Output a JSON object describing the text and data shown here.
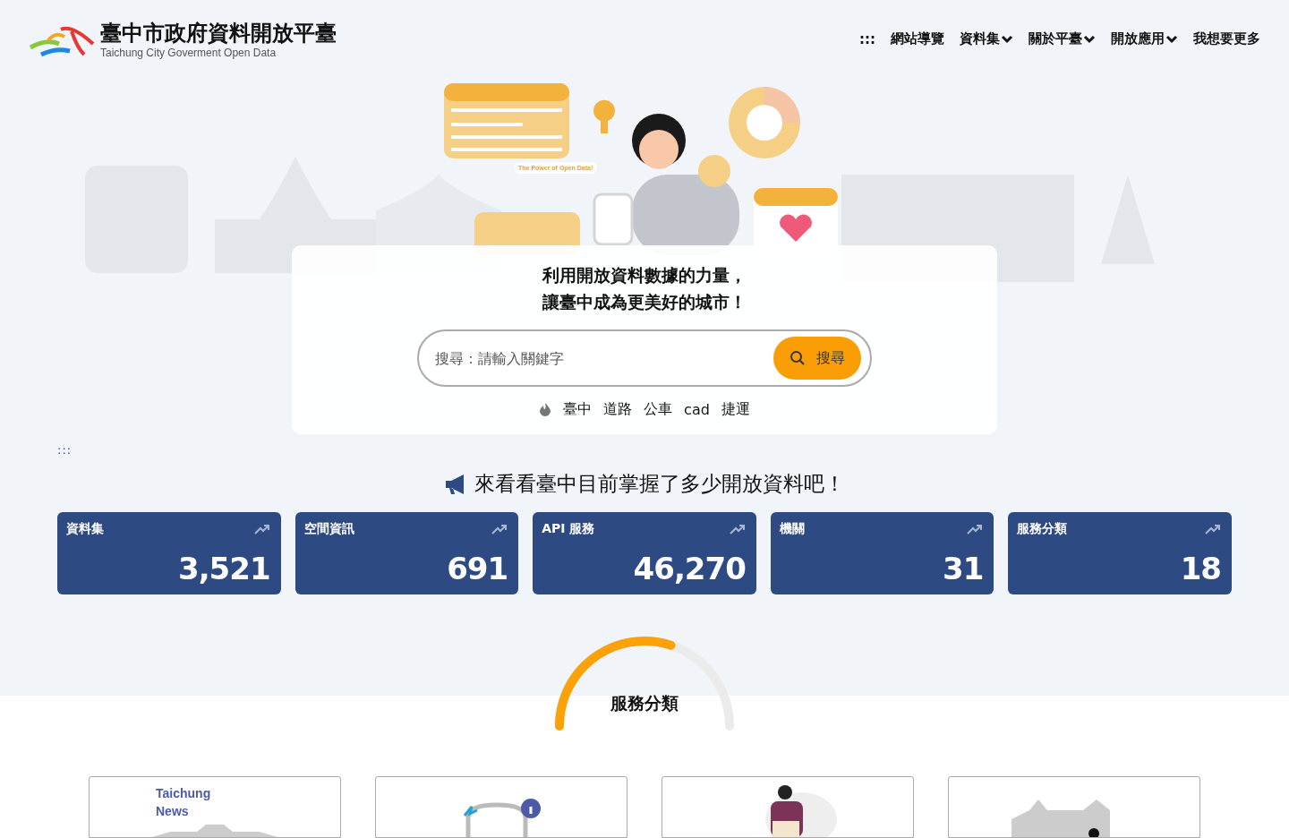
{
  "header": {
    "title": "臺中市政府資料開放平臺",
    "subtitle": "Taichung City Goverment Open Data",
    "nav": [
      {
        "label": ":::",
        "has_menu": false
      },
      {
        "label": "網站導覽",
        "has_menu": false
      },
      {
        "label": "資料集",
        "has_menu": true
      },
      {
        "label": "關於平臺",
        "has_menu": true
      },
      {
        "label": "開放應用",
        "has_menu": true
      },
      {
        "label": "我想要更多",
        "has_menu": false
      }
    ]
  },
  "hero": {
    "bubble": "The Power of Open Data!",
    "slogan": [
      "利用開放資料數據的力量，",
      "讓臺中成為更美好的城市！"
    ],
    "search": {
      "placeholder": "搜尋：請輸入關鍵字",
      "button": "搜尋"
    },
    "hot_keywords": [
      "臺中",
      "道路",
      "公車",
      "cad",
      "捷運"
    ]
  },
  "anchor": ":::",
  "stats": {
    "heading": "來看看臺中目前掌握了多少開放資料吧！",
    "cards": [
      {
        "label": "資料集",
        "value": "3,521"
      },
      {
        "label": "空間資訊",
        "value": "691"
      },
      {
        "label": "API 服務",
        "value": "46,270"
      },
      {
        "label": "機關",
        "value": "31"
      },
      {
        "label": "服務分類",
        "value": "18"
      }
    ]
  },
  "services": {
    "heading": "服務分類",
    "cards": [
      {
        "kind": "news",
        "caption": "Taichung\nNews"
      },
      {
        "kind": "transit"
      },
      {
        "kind": "person"
      },
      {
        "kind": "buildings"
      }
    ]
  }
}
